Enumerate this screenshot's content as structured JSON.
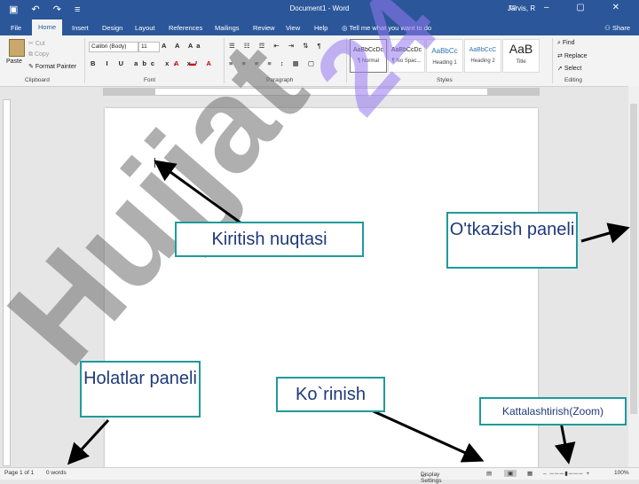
{
  "titlebar": {
    "title": "Document1  -  Word",
    "user": "Jarvis, R",
    "quick_access": "▣ ↶ ↷ ≡"
  },
  "tabs": [
    "File",
    "Home",
    "Insert",
    "Design",
    "Layout",
    "References",
    "Mailings",
    "Review",
    "View",
    "Help"
  ],
  "tell_me": "Tell me what you want to do",
  "share": "Share",
  "clipboard": {
    "paste": "Paste",
    "cut": "Cut",
    "copy": "Copy",
    "format_painter": "Format Painter",
    "group": "Clipboard"
  },
  "font": {
    "name": "Calibri (Body)",
    "size": "11",
    "group": "Font"
  },
  "paragraph": {
    "group": "Paragraph"
  },
  "styles": {
    "group": "Styles",
    "items": [
      {
        "preview": "AaBbCcDc",
        "name": "¶ Normal"
      },
      {
        "preview": "AaBbCcDc",
        "name": "¶ No Spac..."
      },
      {
        "preview": "AaBbCc",
        "name": "Heading 1"
      },
      {
        "preview": "AaBbCcC",
        "name": "Heading 2"
      },
      {
        "preview": "AaB",
        "name": "Title"
      }
    ]
  },
  "editing": {
    "find": "Find",
    "replace": "Replace",
    "select": "Select",
    "group": "Editing"
  },
  "status": {
    "page": "Page 1 of 1",
    "words": "0 words",
    "display_settings": "Display Settings",
    "zoom": "100%"
  },
  "callouts": {
    "insertion_point": "Kiritish nuqtasi",
    "scrollbar": "O'tkazish paneli",
    "status_bar": "Holatlar paneli",
    "view": "Ko`rinish",
    "zoom": "Kattalashtirish(Zoom)"
  },
  "watermark": {
    "grey": "Hujjat",
    "purple": "24"
  },
  "colors": {
    "brand": "#2b579a",
    "callout_border": "#1f9a9a",
    "callout_text": "#1f3a7a"
  }
}
